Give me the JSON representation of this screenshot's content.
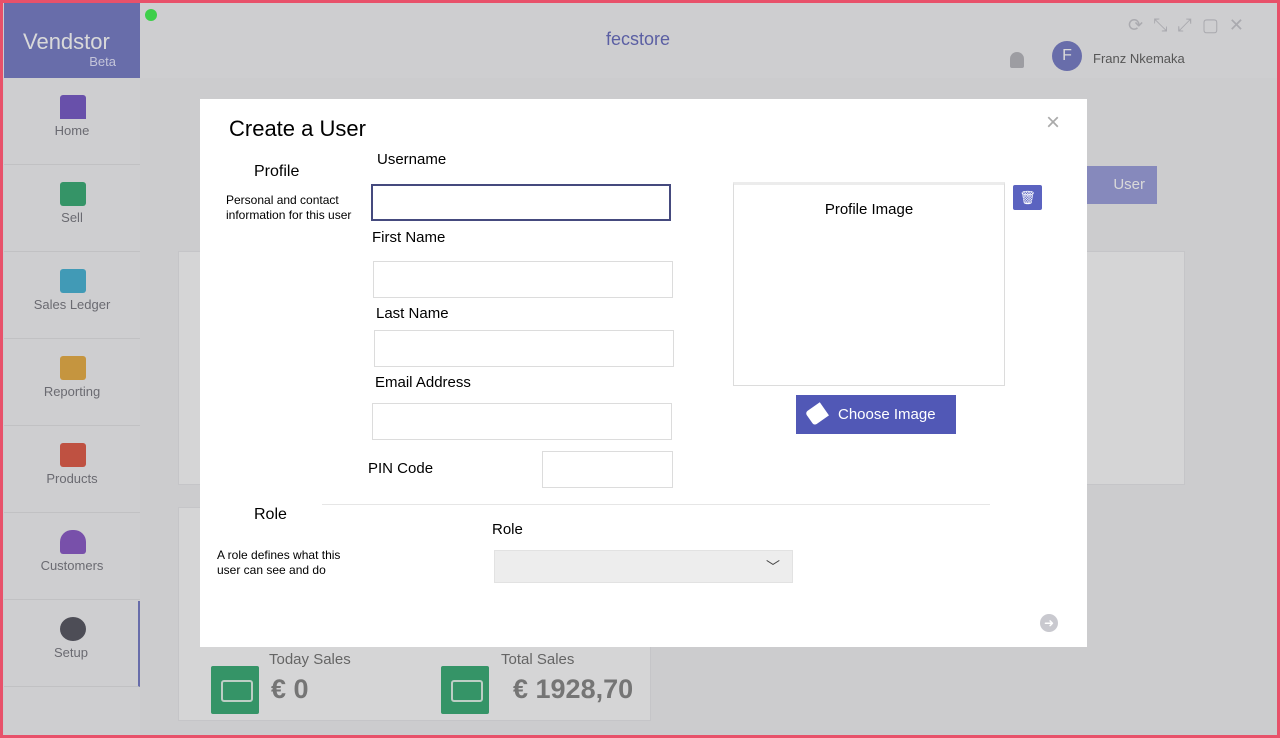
{
  "app": {
    "brand": "Vendstor",
    "brand_badge": "Beta",
    "store_name": "fecstore",
    "user_initial": "F",
    "user_name": "Franz Nkemaka"
  },
  "sidebar": {
    "items": [
      {
        "label": "Home",
        "icon": "home-icon",
        "color": "#7b5ec8"
      },
      {
        "label": "Sell",
        "icon": "register-icon",
        "color": "#3fae79"
      },
      {
        "label": "Sales Ledger",
        "icon": "ledger-icon",
        "color": "#4db6d6"
      },
      {
        "label": "Reporting",
        "icon": "chart-icon",
        "color": "#e8b04a"
      },
      {
        "label": "Products",
        "icon": "box-icon",
        "color": "#e1604d"
      },
      {
        "label": "Customers",
        "icon": "people-icon",
        "color": "#8d5ec8"
      },
      {
        "label": "Setup",
        "icon": "gear-icon",
        "color": "#5b5b66"
      }
    ]
  },
  "background": {
    "add_user_label": "User",
    "stats": [
      {
        "label": "Today Sales",
        "value": "€ 0"
      },
      {
        "label": "Total Sales",
        "value": "€ 1928,70"
      }
    ]
  },
  "modal": {
    "title": "Create a User",
    "profile_section": {
      "title": "Profile",
      "description": "Personal and contact information for this user"
    },
    "fields": {
      "username": {
        "label": "Username",
        "value": ""
      },
      "first_name": {
        "label": "First Name",
        "value": ""
      },
      "last_name": {
        "label": "Last Name",
        "value": ""
      },
      "email": {
        "label": "Email Address",
        "value": ""
      },
      "pin": {
        "label": "PIN Code",
        "value": ""
      }
    },
    "profile_image": {
      "title": "Profile Image",
      "choose_label": "Choose Image"
    },
    "role_section": {
      "title": "Role",
      "description": "A role defines what this user can see and do",
      "field_label": "Role",
      "selected": ""
    }
  },
  "colors": {
    "accent": "#5158b6",
    "brand": "#7b80c8",
    "frame": "#e8516a"
  }
}
